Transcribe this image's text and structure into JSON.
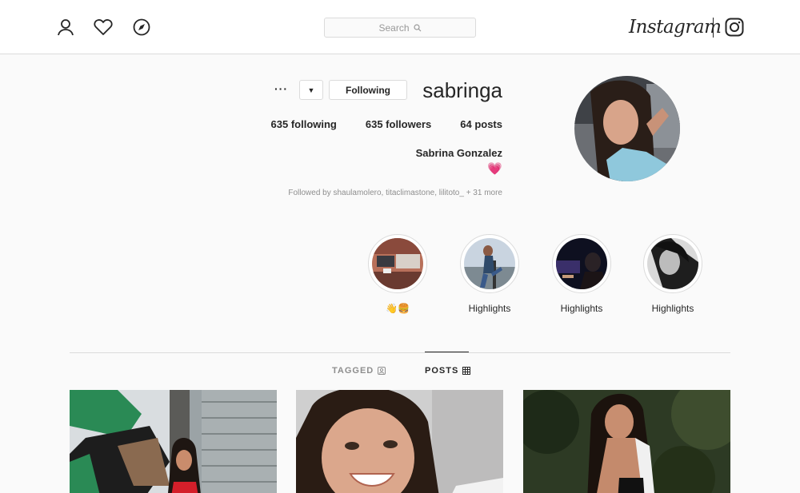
{
  "nav": {
    "search_placeholder": "Search",
    "brand": "Instagram",
    "icons": [
      "profile-icon",
      "heart-icon",
      "explore-compass-icon",
      "search-icon",
      "instagram-camera-icon"
    ]
  },
  "profile": {
    "username": "sabringa",
    "following_label": "Following",
    "stats": {
      "posts": "64 posts",
      "followers": "635 followers",
      "following": "635 following"
    },
    "full_name": "Sabrina Gonzalez",
    "bio": "💗",
    "followed_by": "Followed by shaulamolero, titaclimastone, lilitoto_ + 31 more"
  },
  "highlights": [
    {
      "label": "Highlights"
    },
    {
      "label": "Highlights"
    },
    {
      "label": "Highlights"
    },
    {
      "label": "👋🍔"
    }
  ],
  "tabs": {
    "posts": "POSTS",
    "tagged": "TAGGED"
  },
  "colors": {
    "border": "#dbdbdb",
    "text": "#262626",
    "muted": "#8e8e8e",
    "background": "#fafafa"
  }
}
